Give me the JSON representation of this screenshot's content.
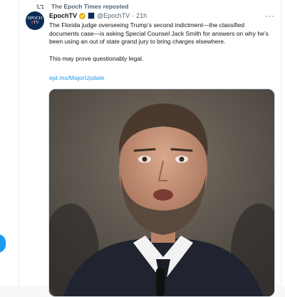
{
  "repost": {
    "label": "The Epoch Times reposted"
  },
  "author": {
    "name": "EpochTV",
    "handle": "@EpochTV",
    "separator": "·",
    "time": "21h",
    "avatar_text_top": "EPOCH",
    "avatar_text_bottom_a": "●",
    "avatar_text_bottom_b": "TV"
  },
  "tweet": {
    "paragraph1": "The Florida judge overseeing Trump’s second indictment—the classified documents case—is asking Special Counsel Jack Smith for answers on why he’s been using an out of state grand jury to bring charges elsewhere.",
    "paragraph2": "This may prove questionably legal.",
    "link": "ept.ms/MajorUpdate",
    "more_label": "···"
  },
  "icons": {
    "repost": "repost-icon",
    "verified": "gold-verified-badge-icon",
    "affiliate": "organization-affiliate-badge-icon",
    "more": "more-horizontal-icon"
  },
  "colors": {
    "accent": "#1d9bf0",
    "text": "#0f1419",
    "muted": "#536471",
    "gold_badge": "#e2b719"
  }
}
